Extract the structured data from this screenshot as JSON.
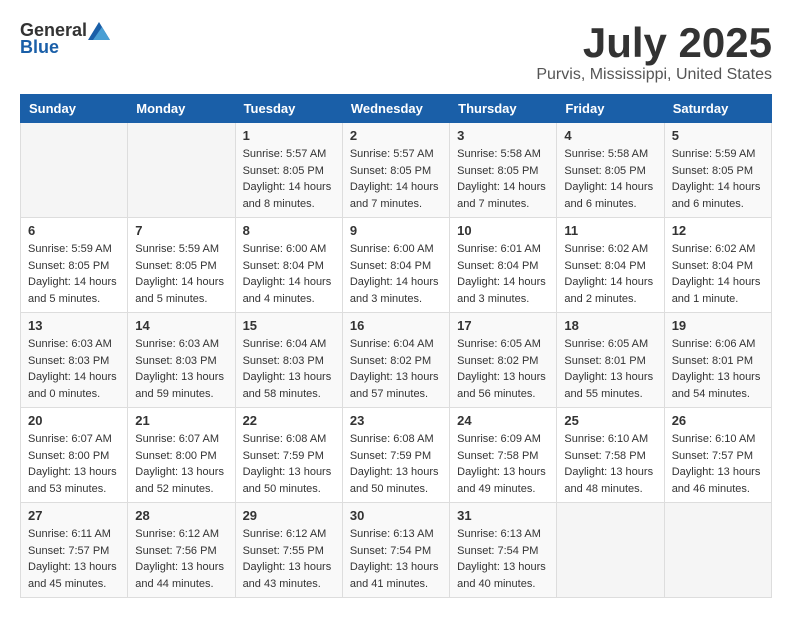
{
  "header": {
    "logo_general": "General",
    "logo_blue": "Blue",
    "month": "July 2025",
    "location": "Purvis, Mississippi, United States"
  },
  "weekdays": [
    "Sunday",
    "Monday",
    "Tuesday",
    "Wednesday",
    "Thursday",
    "Friday",
    "Saturday"
  ],
  "weeks": [
    [
      {
        "day": "",
        "info": ""
      },
      {
        "day": "",
        "info": ""
      },
      {
        "day": "1",
        "info": "Sunrise: 5:57 AM\nSunset: 8:05 PM\nDaylight: 14 hours and 8 minutes."
      },
      {
        "day": "2",
        "info": "Sunrise: 5:57 AM\nSunset: 8:05 PM\nDaylight: 14 hours and 7 minutes."
      },
      {
        "day": "3",
        "info": "Sunrise: 5:58 AM\nSunset: 8:05 PM\nDaylight: 14 hours and 7 minutes."
      },
      {
        "day": "4",
        "info": "Sunrise: 5:58 AM\nSunset: 8:05 PM\nDaylight: 14 hours and 6 minutes."
      },
      {
        "day": "5",
        "info": "Sunrise: 5:59 AM\nSunset: 8:05 PM\nDaylight: 14 hours and 6 minutes."
      }
    ],
    [
      {
        "day": "6",
        "info": "Sunrise: 5:59 AM\nSunset: 8:05 PM\nDaylight: 14 hours and 5 minutes."
      },
      {
        "day": "7",
        "info": "Sunrise: 5:59 AM\nSunset: 8:05 PM\nDaylight: 14 hours and 5 minutes."
      },
      {
        "day": "8",
        "info": "Sunrise: 6:00 AM\nSunset: 8:04 PM\nDaylight: 14 hours and 4 minutes."
      },
      {
        "day": "9",
        "info": "Sunrise: 6:00 AM\nSunset: 8:04 PM\nDaylight: 14 hours and 3 minutes."
      },
      {
        "day": "10",
        "info": "Sunrise: 6:01 AM\nSunset: 8:04 PM\nDaylight: 14 hours and 3 minutes."
      },
      {
        "day": "11",
        "info": "Sunrise: 6:02 AM\nSunset: 8:04 PM\nDaylight: 14 hours and 2 minutes."
      },
      {
        "day": "12",
        "info": "Sunrise: 6:02 AM\nSunset: 8:04 PM\nDaylight: 14 hours and 1 minute."
      }
    ],
    [
      {
        "day": "13",
        "info": "Sunrise: 6:03 AM\nSunset: 8:03 PM\nDaylight: 14 hours and 0 minutes."
      },
      {
        "day": "14",
        "info": "Sunrise: 6:03 AM\nSunset: 8:03 PM\nDaylight: 13 hours and 59 minutes."
      },
      {
        "day": "15",
        "info": "Sunrise: 6:04 AM\nSunset: 8:03 PM\nDaylight: 13 hours and 58 minutes."
      },
      {
        "day": "16",
        "info": "Sunrise: 6:04 AM\nSunset: 8:02 PM\nDaylight: 13 hours and 57 minutes."
      },
      {
        "day": "17",
        "info": "Sunrise: 6:05 AM\nSunset: 8:02 PM\nDaylight: 13 hours and 56 minutes."
      },
      {
        "day": "18",
        "info": "Sunrise: 6:05 AM\nSunset: 8:01 PM\nDaylight: 13 hours and 55 minutes."
      },
      {
        "day": "19",
        "info": "Sunrise: 6:06 AM\nSunset: 8:01 PM\nDaylight: 13 hours and 54 minutes."
      }
    ],
    [
      {
        "day": "20",
        "info": "Sunrise: 6:07 AM\nSunset: 8:00 PM\nDaylight: 13 hours and 53 minutes."
      },
      {
        "day": "21",
        "info": "Sunrise: 6:07 AM\nSunset: 8:00 PM\nDaylight: 13 hours and 52 minutes."
      },
      {
        "day": "22",
        "info": "Sunrise: 6:08 AM\nSunset: 7:59 PM\nDaylight: 13 hours and 50 minutes."
      },
      {
        "day": "23",
        "info": "Sunrise: 6:08 AM\nSunset: 7:59 PM\nDaylight: 13 hours and 50 minutes."
      },
      {
        "day": "24",
        "info": "Sunrise: 6:09 AM\nSunset: 7:58 PM\nDaylight: 13 hours and 49 minutes."
      },
      {
        "day": "25",
        "info": "Sunrise: 6:10 AM\nSunset: 7:58 PM\nDaylight: 13 hours and 48 minutes."
      },
      {
        "day": "26",
        "info": "Sunrise: 6:10 AM\nSunset: 7:57 PM\nDaylight: 13 hours and 46 minutes."
      }
    ],
    [
      {
        "day": "27",
        "info": "Sunrise: 6:11 AM\nSunset: 7:57 PM\nDaylight: 13 hours and 45 minutes."
      },
      {
        "day": "28",
        "info": "Sunrise: 6:12 AM\nSunset: 7:56 PM\nDaylight: 13 hours and 44 minutes."
      },
      {
        "day": "29",
        "info": "Sunrise: 6:12 AM\nSunset: 7:55 PM\nDaylight: 13 hours and 43 minutes."
      },
      {
        "day": "30",
        "info": "Sunrise: 6:13 AM\nSunset: 7:54 PM\nDaylight: 13 hours and 41 minutes."
      },
      {
        "day": "31",
        "info": "Sunrise: 6:13 AM\nSunset: 7:54 PM\nDaylight: 13 hours and 40 minutes."
      },
      {
        "day": "",
        "info": ""
      },
      {
        "day": "",
        "info": ""
      }
    ]
  ]
}
